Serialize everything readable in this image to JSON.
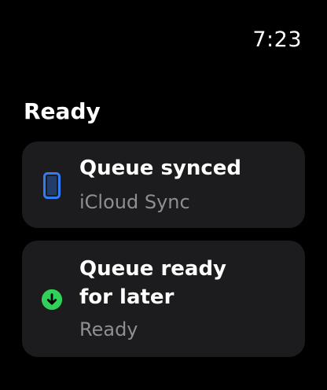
{
  "status_bar": {
    "time": "7:23"
  },
  "section": {
    "title": "Ready"
  },
  "notifications": [
    {
      "title": "Queue synced",
      "subtitle": "iCloud Sync",
      "icon": "phone-icon",
      "icon_color": "#2f7cf6"
    },
    {
      "title_line1": "Queue ready",
      "title_line2": "for later",
      "subtitle": "Ready",
      "icon": "download-icon",
      "icon_color": "#30d158"
    }
  ],
  "colors": {
    "background": "#000000",
    "card": "#1c1c1e",
    "secondary_text": "#8e8e93"
  }
}
